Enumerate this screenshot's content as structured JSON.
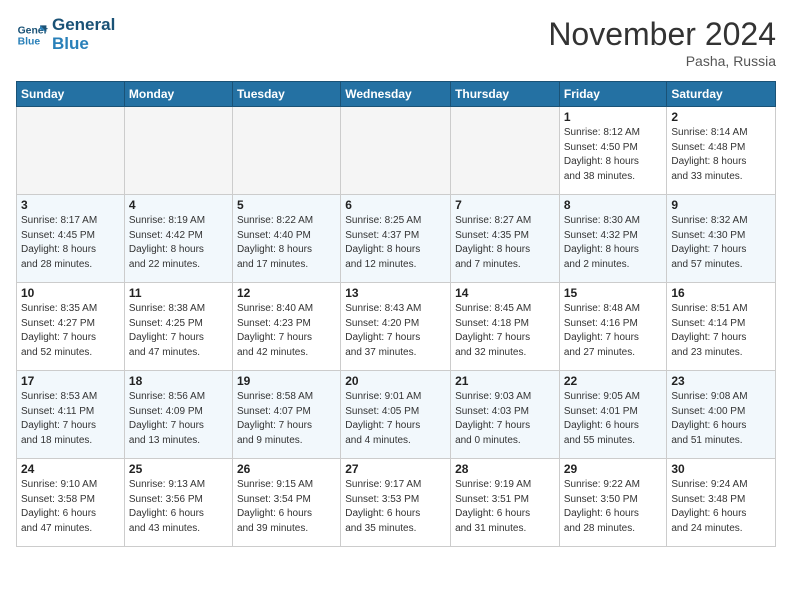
{
  "logo": {
    "line1": "General",
    "line2": "Blue"
  },
  "title": "November 2024",
  "location": "Pasha, Russia",
  "days_of_week": [
    "Sunday",
    "Monday",
    "Tuesday",
    "Wednesday",
    "Thursday",
    "Friday",
    "Saturday"
  ],
  "weeks": [
    [
      {
        "day": "",
        "info": ""
      },
      {
        "day": "",
        "info": ""
      },
      {
        "day": "",
        "info": ""
      },
      {
        "day": "",
        "info": ""
      },
      {
        "day": "",
        "info": ""
      },
      {
        "day": "1",
        "info": "Sunrise: 8:12 AM\nSunset: 4:50 PM\nDaylight: 8 hours\nand 38 minutes."
      },
      {
        "day": "2",
        "info": "Sunrise: 8:14 AM\nSunset: 4:48 PM\nDaylight: 8 hours\nand 33 minutes."
      }
    ],
    [
      {
        "day": "3",
        "info": "Sunrise: 8:17 AM\nSunset: 4:45 PM\nDaylight: 8 hours\nand 28 minutes."
      },
      {
        "day": "4",
        "info": "Sunrise: 8:19 AM\nSunset: 4:42 PM\nDaylight: 8 hours\nand 22 minutes."
      },
      {
        "day": "5",
        "info": "Sunrise: 8:22 AM\nSunset: 4:40 PM\nDaylight: 8 hours\nand 17 minutes."
      },
      {
        "day": "6",
        "info": "Sunrise: 8:25 AM\nSunset: 4:37 PM\nDaylight: 8 hours\nand 12 minutes."
      },
      {
        "day": "7",
        "info": "Sunrise: 8:27 AM\nSunset: 4:35 PM\nDaylight: 8 hours\nand 7 minutes."
      },
      {
        "day": "8",
        "info": "Sunrise: 8:30 AM\nSunset: 4:32 PM\nDaylight: 8 hours\nand 2 minutes."
      },
      {
        "day": "9",
        "info": "Sunrise: 8:32 AM\nSunset: 4:30 PM\nDaylight: 7 hours\nand 57 minutes."
      }
    ],
    [
      {
        "day": "10",
        "info": "Sunrise: 8:35 AM\nSunset: 4:27 PM\nDaylight: 7 hours\nand 52 minutes."
      },
      {
        "day": "11",
        "info": "Sunrise: 8:38 AM\nSunset: 4:25 PM\nDaylight: 7 hours\nand 47 minutes."
      },
      {
        "day": "12",
        "info": "Sunrise: 8:40 AM\nSunset: 4:23 PM\nDaylight: 7 hours\nand 42 minutes."
      },
      {
        "day": "13",
        "info": "Sunrise: 8:43 AM\nSunset: 4:20 PM\nDaylight: 7 hours\nand 37 minutes."
      },
      {
        "day": "14",
        "info": "Sunrise: 8:45 AM\nSunset: 4:18 PM\nDaylight: 7 hours\nand 32 minutes."
      },
      {
        "day": "15",
        "info": "Sunrise: 8:48 AM\nSunset: 4:16 PM\nDaylight: 7 hours\nand 27 minutes."
      },
      {
        "day": "16",
        "info": "Sunrise: 8:51 AM\nSunset: 4:14 PM\nDaylight: 7 hours\nand 23 minutes."
      }
    ],
    [
      {
        "day": "17",
        "info": "Sunrise: 8:53 AM\nSunset: 4:11 PM\nDaylight: 7 hours\nand 18 minutes."
      },
      {
        "day": "18",
        "info": "Sunrise: 8:56 AM\nSunset: 4:09 PM\nDaylight: 7 hours\nand 13 minutes."
      },
      {
        "day": "19",
        "info": "Sunrise: 8:58 AM\nSunset: 4:07 PM\nDaylight: 7 hours\nand 9 minutes."
      },
      {
        "day": "20",
        "info": "Sunrise: 9:01 AM\nSunset: 4:05 PM\nDaylight: 7 hours\nand 4 minutes."
      },
      {
        "day": "21",
        "info": "Sunrise: 9:03 AM\nSunset: 4:03 PM\nDaylight: 7 hours\nand 0 minutes."
      },
      {
        "day": "22",
        "info": "Sunrise: 9:05 AM\nSunset: 4:01 PM\nDaylight: 6 hours\nand 55 minutes."
      },
      {
        "day": "23",
        "info": "Sunrise: 9:08 AM\nSunset: 4:00 PM\nDaylight: 6 hours\nand 51 minutes."
      }
    ],
    [
      {
        "day": "24",
        "info": "Sunrise: 9:10 AM\nSunset: 3:58 PM\nDaylight: 6 hours\nand 47 minutes."
      },
      {
        "day": "25",
        "info": "Sunrise: 9:13 AM\nSunset: 3:56 PM\nDaylight: 6 hours\nand 43 minutes."
      },
      {
        "day": "26",
        "info": "Sunrise: 9:15 AM\nSunset: 3:54 PM\nDaylight: 6 hours\nand 39 minutes."
      },
      {
        "day": "27",
        "info": "Sunrise: 9:17 AM\nSunset: 3:53 PM\nDaylight: 6 hours\nand 35 minutes."
      },
      {
        "day": "28",
        "info": "Sunrise: 9:19 AM\nSunset: 3:51 PM\nDaylight: 6 hours\nand 31 minutes."
      },
      {
        "day": "29",
        "info": "Sunrise: 9:22 AM\nSunset: 3:50 PM\nDaylight: 6 hours\nand 28 minutes."
      },
      {
        "day": "30",
        "info": "Sunrise: 9:24 AM\nSunset: 3:48 PM\nDaylight: 6 hours\nand 24 minutes."
      }
    ]
  ]
}
